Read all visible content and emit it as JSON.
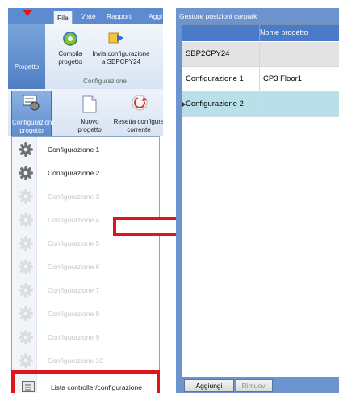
{
  "ribbon": {
    "tabs": [
      "File",
      "Viste",
      "Rapporti",
      "Aggi"
    ],
    "project_button": "Progetto",
    "compile_label_1": "Compila",
    "compile_label_2": "progetto",
    "send_label_1": "Invia configurazione",
    "send_label_2": "a SBPCPY24",
    "group_label": "Configurazione",
    "configs_label_1": "Configurazioni",
    "configs_label_2": "progetto",
    "new_label_1": "Nuovo",
    "new_label_2": "progetto",
    "reset_label_1": "Resetta configura",
    "reset_label_2": "corrente"
  },
  "dropdown": {
    "items": [
      {
        "label": "Configurazione 1",
        "enabled": true
      },
      {
        "label": "Configurazione 2",
        "enabled": true
      },
      {
        "label": "Configurazione 3",
        "enabled": false
      },
      {
        "label": "Configurazione 4",
        "enabled": false
      },
      {
        "label": "Configurazione 5",
        "enabled": false
      },
      {
        "label": "Configurazione 6",
        "enabled": false
      },
      {
        "label": "Configurazione 7",
        "enabled": false
      },
      {
        "label": "Configurazione 8",
        "enabled": false
      },
      {
        "label": "Configurazione 9",
        "enabled": false
      },
      {
        "label": "Configurazione 10",
        "enabled": false
      }
    ],
    "list_item": "Lista controller/configurazione"
  },
  "window": {
    "title": "Gestore posizioni carpark",
    "column_header": "Nome progetto",
    "rows": [
      {
        "col1": "SBP2CPY24",
        "col2": ""
      },
      {
        "col1": "Configurazione 1",
        "col2": "CP3 Floor1"
      },
      {
        "col1": "Configurazione 2",
        "col2": ""
      }
    ],
    "add_button": "Aggiungi",
    "remove_button": "Rimuovi"
  },
  "colors": {
    "highlight": "#e0141a",
    "ribbon_blue": "#5d8bcf",
    "selected_row": "#b9dfe8"
  }
}
